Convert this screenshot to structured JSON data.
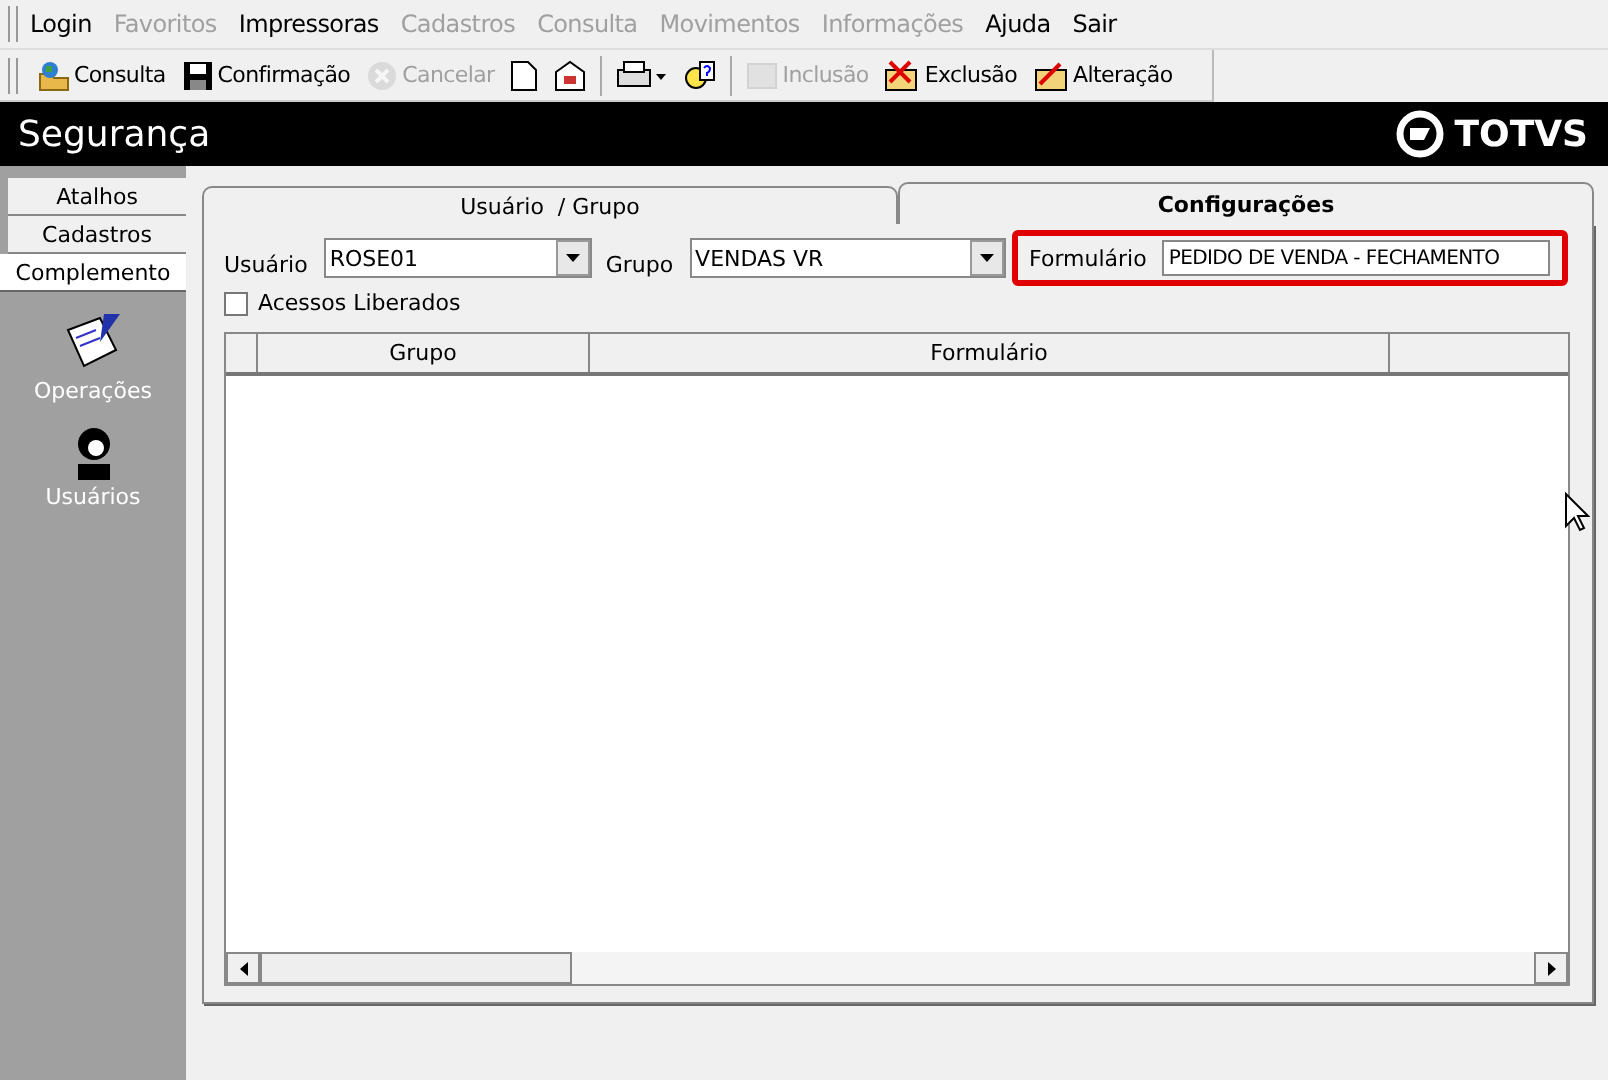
{
  "menu": [
    {
      "label": "Login",
      "disabled": false
    },
    {
      "label": "Favoritos",
      "disabled": true
    },
    {
      "label": "Impressoras",
      "disabled": false
    },
    {
      "label": "Cadastros",
      "disabled": true
    },
    {
      "label": "Consulta",
      "disabled": true
    },
    {
      "label": "Movimentos",
      "disabled": true
    },
    {
      "label": "Informações",
      "disabled": true
    },
    {
      "label": "Ajuda",
      "disabled": false
    },
    {
      "label": "Sair",
      "disabled": false
    }
  ],
  "toolbar": [
    {
      "kind": "globe",
      "label": "Consulta",
      "disabled": false
    },
    {
      "kind": "save",
      "label": "Confirmação",
      "disabled": false
    },
    {
      "kind": "cancel",
      "label": "Cancelar",
      "disabled": true
    },
    {
      "kind": "page",
      "disabled": false
    },
    {
      "kind": "export",
      "disabled": false
    },
    {
      "kind": "sep"
    },
    {
      "kind": "print",
      "disabled": false
    },
    {
      "kind": "help",
      "disabled": false
    },
    {
      "kind": "sep"
    },
    {
      "kind": "add",
      "label": "Inclusão",
      "disabled": true
    },
    {
      "kind": "delete",
      "label": "Exclusão",
      "disabled": false
    },
    {
      "kind": "edit",
      "label": "Alteração",
      "disabled": false
    }
  ],
  "header": {
    "title": "Segurança",
    "brand": "TOTVS"
  },
  "sidebar": {
    "tabs": [
      {
        "label": "Atalhos",
        "selected": false
      },
      {
        "label": "Cadastros",
        "selected": false
      },
      {
        "label": "Complemento",
        "selected": true
      }
    ],
    "items": [
      {
        "kind": "operations",
        "label": "Operações"
      },
      {
        "kind": "users",
        "label": "Usuários"
      }
    ]
  },
  "tabs": [
    {
      "label": "Usuário  / Grupo",
      "selected": false
    },
    {
      "label": "Configurações",
      "selected": true
    }
  ],
  "form": {
    "user": {
      "label": "Usuário",
      "value": "ROSE01"
    },
    "group": {
      "label": "Grupo",
      "value": "VENDAS VR"
    },
    "form": {
      "label": "Formulário",
      "value": "PEDIDO DE VENDA - FECHAMENTO",
      "highlighted": true
    },
    "released": {
      "label": "Acessos Liberados",
      "checked": false
    }
  },
  "table": {
    "columns": [
      "Grupo",
      "Formulário"
    ]
  }
}
